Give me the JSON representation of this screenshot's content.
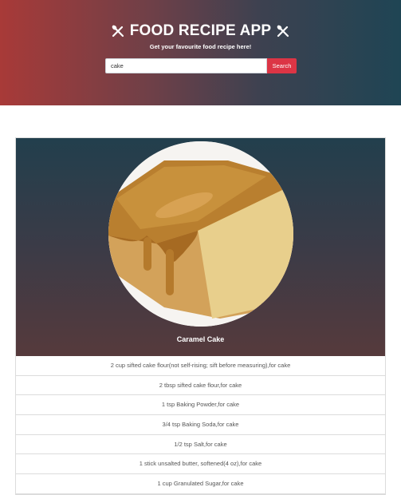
{
  "header": {
    "title": "FOOD RECIPE APP",
    "subtitle": "Get your favourite food recipe here!",
    "left_icon": "fork-spoon-icon",
    "right_icon": "fork-spoon-icon"
  },
  "search": {
    "value": "cake",
    "button_label": "Search"
  },
  "recipe": {
    "title": "Caramel Cake",
    "image": "caramel-cake-photo",
    "ingredients": [
      "2 cup sifted cake flour(not self-rising; sift before measuring),for cake",
      "2 tbsp sifted cake flour,for cake",
      "1 tsp Baking Powder,for cake",
      "3/4 tsp Baking Soda,for cake",
      "1/2 tsp Salt,for cake",
      "1 stick unsalted butter, softened(4 oz),for cake",
      "1 cup Granulated Sugar,for cake"
    ]
  },
  "colors": {
    "header_left": "#a83a38",
    "header_right": "#1f4554",
    "search_button": "#dc3545",
    "card_top": "#223f4d",
    "card_bottom": "#563a3c"
  }
}
